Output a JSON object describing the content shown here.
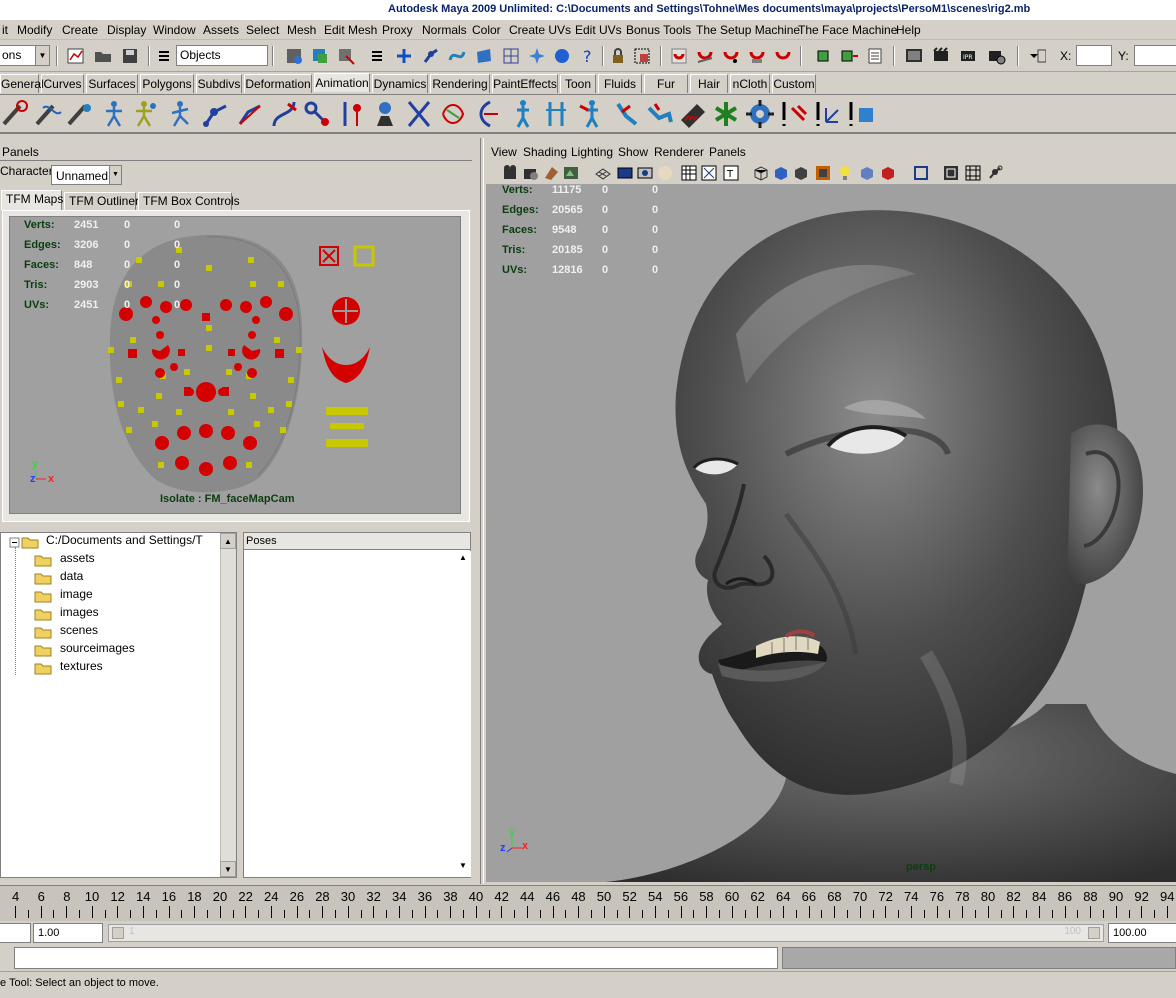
{
  "title": "Autodesk Maya 2009 Unlimited: C:\\Documents and Settings\\Tohne\\Mes documents\\maya\\projects\\PersoM1\\scenes\\rig2.mb",
  "menu": [
    "it",
    "Modify",
    "Create",
    "Display",
    "Window",
    "Assets",
    "Select",
    "Mesh",
    "Edit Mesh",
    "Proxy",
    "Normals",
    "Color",
    "Create UVs",
    "Edit UVs",
    "Bonus Tools",
    "The Setup Machine",
    "The Face Machine",
    "Help"
  ],
  "statusline": {
    "mode_value": "ons",
    "selection_mask": "Objects",
    "x_label": "X:",
    "y_label": "Y:"
  },
  "shelf_tabs": [
    "General",
    "Curves",
    "Surfaces",
    "Polygons",
    "Subdivs",
    "Deformation",
    "Animation",
    "Dynamics",
    "Rendering",
    "PaintEffects",
    "Toon",
    "Fluids",
    "Fur",
    "Hair",
    "nCloth",
    "Custom"
  ],
  "left_panel": {
    "panels_label": "Panels",
    "character_label": "Character",
    "character_value": "Unnamed",
    "tabs": [
      "TFM Maps",
      "TFM Outliner",
      "TFM Box Controls"
    ],
    "hud": [
      {
        "label": "Verts:",
        "v1": "2451",
        "v2": "0",
        "v3": "0"
      },
      {
        "label": "Edges:",
        "v1": "3206",
        "v2": "0",
        "v3": "0"
      },
      {
        "label": "Faces:",
        "v1": "848",
        "v2": "0",
        "v3": "0"
      },
      {
        "label": "Tris:",
        "v1": "2903",
        "v2": "0",
        "v3": "0"
      },
      {
        "label": "UVs:",
        "v1": "2451",
        "v2": "0",
        "v3": "0"
      }
    ],
    "isolate_label": "Isolate : FM_faceMapCam",
    "axis_y": "y",
    "axis_z": "z",
    "axis_x": "x"
  },
  "file_tree": {
    "root": "C:/Documents and Settings/T",
    "folders": [
      "assets",
      "data",
      "image",
      "images",
      "scenes",
      "sourceimages",
      "textures"
    ]
  },
  "poses": {
    "header": "Poses"
  },
  "viewport": {
    "menu": [
      "View",
      "Shading",
      "Lighting",
      "Show",
      "Renderer",
      "Panels"
    ],
    "hud": [
      {
        "label": "Verts:",
        "v1": "11175",
        "v2": "0",
        "v3": "0"
      },
      {
        "label": "Edges:",
        "v1": "20565",
        "v2": "0",
        "v3": "0"
      },
      {
        "label": "Faces:",
        "v1": "9548",
        "v2": "0",
        "v3": "0"
      },
      {
        "label": "Tris:",
        "v1": "20185",
        "v2": "0",
        "v3": "0"
      },
      {
        "label": "UVs:",
        "v1": "12816",
        "v2": "0",
        "v3": "0"
      }
    ],
    "camera": "persp",
    "axis_y": "y",
    "axis_z": "z",
    "axis_x": "x"
  },
  "timeline": {
    "ticks": [
      "4",
      "6",
      "8",
      "10",
      "12",
      "14",
      "16",
      "18",
      "20",
      "22",
      "24",
      "26",
      "28",
      "30",
      "32",
      "34",
      "36",
      "38",
      "40",
      "42",
      "44",
      "46",
      "48",
      "50",
      "52",
      "54",
      "56",
      "58",
      "60",
      "62",
      "64",
      "66",
      "68",
      "70",
      "72",
      "74",
      "76",
      "78",
      "80",
      "82",
      "84",
      "86",
      "88",
      "90",
      "92",
      "94"
    ]
  },
  "range": {
    "start": "1.00",
    "slider_start": "1",
    "slider_end": "100",
    "end": "100.00"
  },
  "help_line": "e Tool: Select an object to move.",
  "colors": {
    "ui_bg": "#d4d0c8",
    "hud_label": "#0b3d10",
    "face_red": "#d40000",
    "face_yellow": "#c8c800",
    "viewport_bg": "#a0a0a0"
  }
}
